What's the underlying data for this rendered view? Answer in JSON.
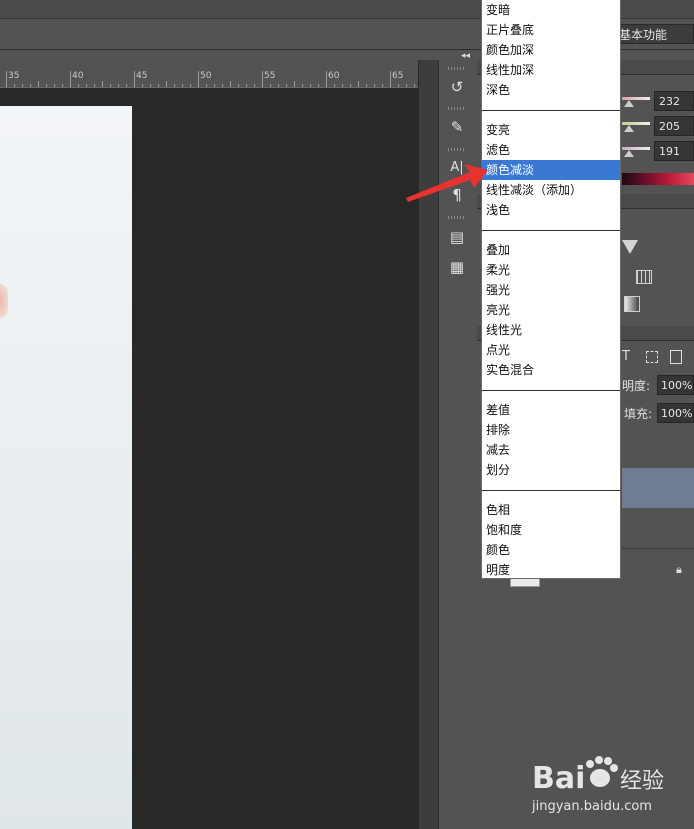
{
  "workspace": {
    "label": "基本功能"
  },
  "ruler": {
    "ticks": [
      "35",
      "40",
      "45",
      "50",
      "55",
      "60",
      "65"
    ]
  },
  "color_panel": {
    "values": [
      "232",
      "205",
      "191"
    ],
    "slider_colors": [
      "#d9a2a6",
      "#b9d08a",
      "#c9a8c8"
    ]
  },
  "layers_panel": {
    "opacity_label": "明度:",
    "opacity_value": "100%",
    "fill_label": "填充:",
    "fill_value": "100%",
    "filter_icons": [
      "type-t-icon",
      "transform-icon",
      "smart-object-icon"
    ]
  },
  "blend_mode_menu": {
    "groups": [
      [
        "变暗",
        "正片叠底",
        "颜色加深",
        "线性加深",
        "深色"
      ],
      [
        "变亮",
        "滤色",
        "颜色减淡",
        "线性减淡（添加）",
        "浅色"
      ],
      [
        "叠加",
        "柔光",
        "强光",
        "亮光",
        "线性光",
        "点光",
        "实色混合"
      ],
      [
        "差值",
        "排除",
        "减去",
        "划分"
      ],
      [
        "色相",
        "饱和度",
        "颜色",
        "明度"
      ]
    ],
    "selected": "颜色减淡",
    "selected_color": "#3a78d5"
  },
  "annotation": {
    "arrow_color": "#e8322f"
  },
  "watermark": {
    "brand": "Bai",
    "brand_suffix": "经验",
    "url": "jingyan.baidu.com"
  }
}
